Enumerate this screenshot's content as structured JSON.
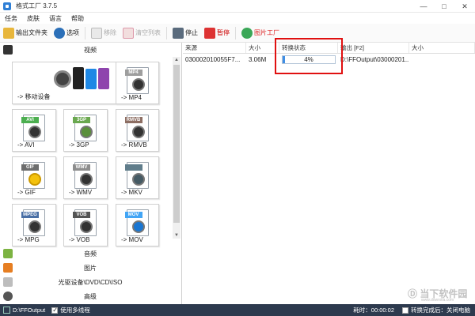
{
  "window": {
    "title": "格式工厂 3.7.5",
    "controls": [
      "—",
      "□",
      "✕"
    ]
  },
  "menu": [
    "任务",
    "皮肤",
    "语言",
    "帮助"
  ],
  "toolbar": {
    "output_folder": "输出文件夹",
    "options": "选项",
    "remove": "移除",
    "clear_list": "清空列表",
    "stop": "停止",
    "pause": "暂停",
    "picture_factory": "图片工厂"
  },
  "left": {
    "video_header": "视频",
    "tiles": [
      {
        "label": "-> 移动设备"
      },
      {
        "label": "-> MP4",
        "badge": "MP4",
        "color": "#9e9e9e"
      },
      {
        "label": "-> AVI",
        "badge": "AVI",
        "color": "#4caf50"
      },
      {
        "label": "-> 3GP",
        "badge": "3GP",
        "color": "#6aa84f"
      },
      {
        "label": "-> RMVB",
        "badge": "RMVB",
        "color": "#8d6e63"
      },
      {
        "label": "-> GIF",
        "badge": "GIF",
        "color": "#6d6d6d"
      },
      {
        "label": "-> WMV",
        "badge": "WMV",
        "color": "#8d8d8d"
      },
      {
        "label": "-> MKV",
        "badge": "",
        "color": "#607d8b"
      },
      {
        "label": "-> MPG",
        "badge": "MPEG",
        "color": "#4a6fa5"
      },
      {
        "label": "-> VOB",
        "badge": "VOB",
        "color": "#555555"
      },
      {
        "label": "-> MOV",
        "badge": "MOV",
        "color": "#42a5f5"
      }
    ],
    "categories": [
      "音频",
      "图片",
      "光驱设备\\DVD\\CD\\ISO",
      "高级"
    ]
  },
  "table": {
    "headers": [
      "来源",
      "大小",
      "转换状态",
      "输出 [F2]",
      "大小"
    ],
    "rows": [
      {
        "source": "030002010055F7...",
        "size": "3.06M",
        "progress": 4,
        "progress_text": "4%",
        "output": "D:\\FFOutput\\03000201...",
        "out_size": ""
      }
    ]
  },
  "status": {
    "path": "D:\\FFOutput",
    "multithread": "使用多线程",
    "elapsed_label": "耗时：00:00:02",
    "after_done": "转换完成后：关闭电脑"
  },
  "watermark": {
    "text": "当下软件园",
    "sub": "www.downxia.com"
  },
  "colors": {
    "statusbar": "#2d3a4e",
    "progress": "#3f8ee5",
    "highlight": "#e01010"
  }
}
